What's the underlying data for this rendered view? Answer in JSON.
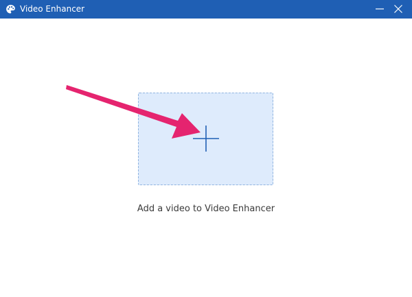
{
  "window": {
    "title": "Video Enhancer",
    "titlebar_color": "#1f5fb4",
    "icon": "palette-icon"
  },
  "controls": {
    "minimize_icon": "minimize-icon",
    "close_icon": "close-icon"
  },
  "main": {
    "drop_zone_icon": "plus-icon",
    "drop_zone_color": "#deebfc",
    "add_label": "Add a video to Video Enhancer"
  },
  "annotation": {
    "arrow_icon": "arrow-icon",
    "arrow_color": "#e5246f"
  }
}
